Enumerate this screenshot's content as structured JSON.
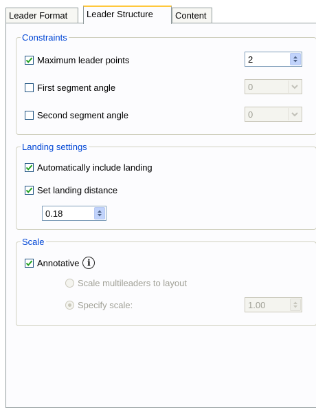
{
  "tabs": {
    "leader_format": "Leader Format",
    "leader_structure": "Leader Structure",
    "content": "Content"
  },
  "constraints": {
    "legend": "Constraints",
    "max_leader_points": {
      "label": "Maximum leader points",
      "checked": true,
      "value": "2"
    },
    "first_segment_angle": {
      "label": "First segment angle",
      "checked": false,
      "value": "0"
    },
    "second_segment_angle": {
      "label": "Second segment angle",
      "checked": false,
      "value": "0"
    }
  },
  "landing": {
    "legend": "Landing settings",
    "auto_include": {
      "label": "Automatically include landing",
      "checked": true
    },
    "set_distance": {
      "label": "Set landing distance",
      "checked": true
    },
    "distance_value": "0.18"
  },
  "scale": {
    "legend": "Scale",
    "annotative": {
      "label": "Annotative",
      "checked": true
    },
    "info_icon": "i",
    "scale_to_layout": {
      "label": "Scale multileaders to layout",
      "selected": false
    },
    "specify_scale": {
      "label": "Specify scale:",
      "selected": true,
      "value": "1.00"
    }
  },
  "colors": {
    "legend_text": "#0046d5",
    "active_tab_highlight": "#ffc83c",
    "check_mark": "#21a121",
    "disabled_text": "#a0a096"
  }
}
